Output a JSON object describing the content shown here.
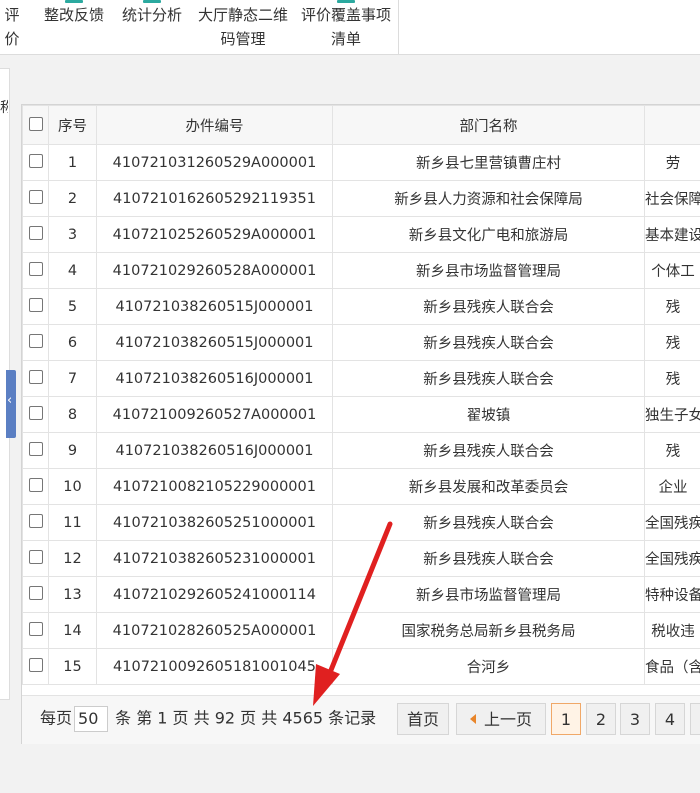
{
  "nav": {
    "items": [
      {
        "label": "评价"
      },
      {
        "label": "整改反馈"
      },
      {
        "label": "统计分析"
      },
      {
        "label_line1": "大厅静态二维",
        "label_line2": "码管理"
      },
      {
        "label_line1": "评价覆盖事项",
        "label_line2": "清单"
      }
    ]
  },
  "side": {
    "cut_text": "称"
  },
  "table": {
    "headers": {
      "seq": "序号",
      "case_no": "办件编号",
      "dept": "部门名称",
      "item": ""
    },
    "rows": [
      {
        "seq": "1",
        "case_no": "410721031260529A000001",
        "dept": "新乡县七里营镇曹庄村",
        "item": "劳"
      },
      {
        "seq": "2",
        "case_no": "4107210162605292119351",
        "dept": "新乡县人力资源和社会保障局",
        "item": "社会保障"
      },
      {
        "seq": "3",
        "case_no": "410721025260529A000001",
        "dept": "新乡县文化广电和旅游局",
        "item": "基本建设"
      },
      {
        "seq": "4",
        "case_no": "410721029260528A000001",
        "dept": "新乡县市场监督管理局",
        "item": "个体工"
      },
      {
        "seq": "5",
        "case_no": "410721038260515J000001",
        "dept": "新乡县残疾人联合会",
        "item": "残"
      },
      {
        "seq": "6",
        "case_no": "410721038260515J000001",
        "dept": "新乡县残疾人联合会",
        "item": "残"
      },
      {
        "seq": "7",
        "case_no": "410721038260516J000001",
        "dept": "新乡县残疾人联合会",
        "item": "残"
      },
      {
        "seq": "8",
        "case_no": "410721009260527A000001",
        "dept": "翟坡镇",
        "item": "独生子女"
      },
      {
        "seq": "9",
        "case_no": "410721038260516J000001",
        "dept": "新乡县残疾人联合会",
        "item": "残"
      },
      {
        "seq": "10",
        "case_no": "410721008210522900000​1",
        "dept": "新乡县发展和改革委员会",
        "item": "企业"
      },
      {
        "seq": "11",
        "case_no": "410721038260525100000​1",
        "dept": "新乡县残疾人联合会",
        "item": "全国残疾"
      },
      {
        "seq": "12",
        "case_no": "410721038260523100000​1",
        "dept": "新乡县残疾人联合会",
        "item": "全国残疾"
      },
      {
        "seq": "13",
        "case_no": "4107210292605241000114",
        "dept": "新乡县市场监督管理局",
        "item": "特种设备"
      },
      {
        "seq": "14",
        "case_no": "410721028260525A000001",
        "dept": "国家税务总局新乡县税务局",
        "item": "税收违"
      },
      {
        "seq": "15",
        "case_no": "4107210092605181001045",
        "dept": "合河乡",
        "item": "食品（含"
      }
    ]
  },
  "pager": {
    "per_page_label": "每页",
    "per_page_value": "50",
    "info_text": "条 第 1 页 共 92 页 共 4565 条记录",
    "first": "首页",
    "prev": "上一页",
    "pages": [
      "1",
      "2",
      "3",
      "4"
    ]
  },
  "colors": {
    "accent": "#2ba99f",
    "current_page": "#f0a868",
    "arrow": "#e02020",
    "collapse_tab": "#5b7fc3"
  }
}
